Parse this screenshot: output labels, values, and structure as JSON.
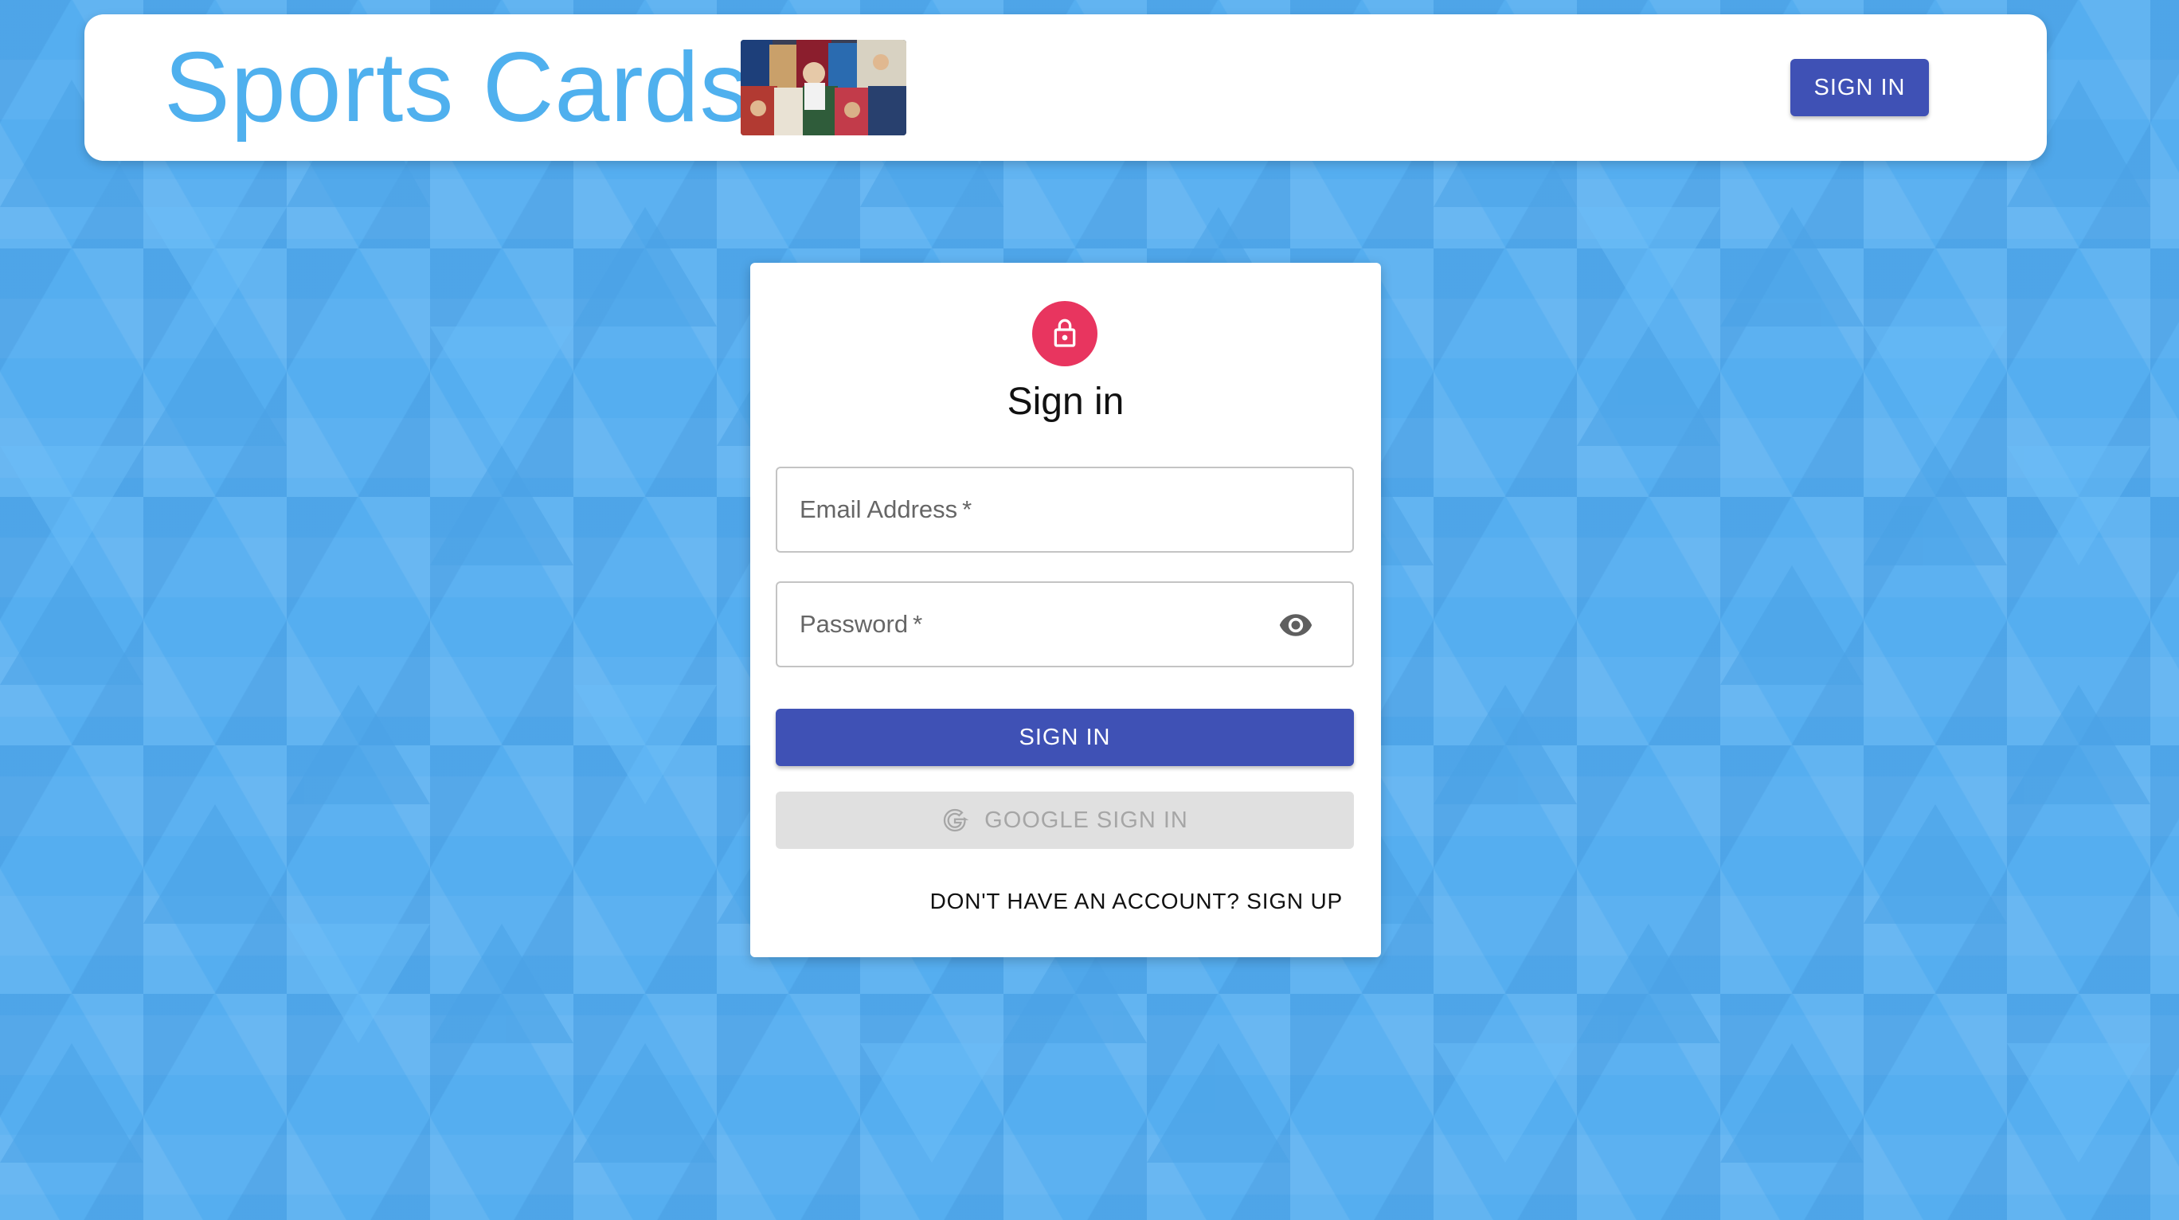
{
  "header": {
    "brand_title": "Sports Cards",
    "sign_in_label": "SIGN IN"
  },
  "signin_card": {
    "title": "Sign in",
    "email_label": "Email Address",
    "password_label": "Password",
    "required_mark": "*",
    "submit_label": "SIGN IN",
    "google_label": "GOOGLE SIGN IN",
    "signup_link": "DON'T HAVE AN ACCOUNT? SIGN UP"
  },
  "icons": {
    "lock": "lock-icon",
    "visibility": "eye-icon",
    "google": "google-g-icon"
  },
  "colors": {
    "background": "#55aef0",
    "brand_text": "#4fb0ee",
    "primary": "#3f51b5",
    "lock_avatar": "#e8355f",
    "disabled_button": "#e0e0e0",
    "disabled_text": "#a6a6a6"
  }
}
